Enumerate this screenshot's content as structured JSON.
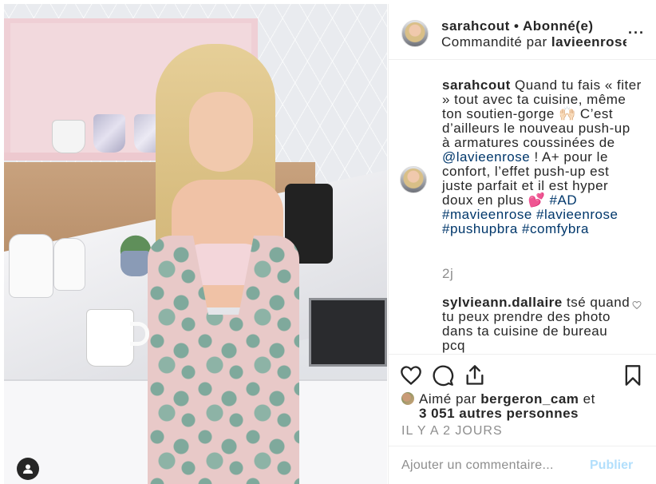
{
  "post": {
    "author": "sarahcout",
    "follow_status": "Abonné(e)",
    "sponsored_prefix": "Commandité par",
    "sponsor": "lavieenrose"
  },
  "caption": {
    "user": "sarahcout",
    "text_1": "Quand tu fais « fiter » tout avec ta cuisine, même ton soutien-gorge 🙌🏻 C’est d’ailleurs le nouveau push-up à armatures coussinées de",
    "mention": "@lavieenrose",
    "text_2": "! A+ pour le confort, l’effet push-up est juste parfait et il est hyper doux en plus 💕",
    "hashtags": [
      "#AD",
      "#mavieenrose",
      "#lavieenrose",
      "#pushupbra",
      "#comfybra"
    ],
    "time": "2j"
  },
  "comment": {
    "user": "sylvieann.dallaire",
    "text": "tsé quand tu peux prendre des photo dans ta cuisine de bureau pcq"
  },
  "likes": {
    "prefix": "Aimé par",
    "user": "bergeron_cam",
    "connector": "et",
    "others": "3 051 autres personnes"
  },
  "timestamp": "IL Y A 2 JOURS",
  "add_comment": {
    "placeholder": "Ajouter un commentaire...",
    "publish_label": "Publier"
  },
  "icons": {
    "like": "heart-icon",
    "comment": "comment-icon",
    "share": "share-icon",
    "save": "bookmark-icon",
    "more": "more-options-icon",
    "tag": "user-tag-icon"
  },
  "colors": {
    "link": "#00376b",
    "secondary_text": "#8e8e8e",
    "publish_disabled": "#b2dffc",
    "border": "#efefef"
  }
}
